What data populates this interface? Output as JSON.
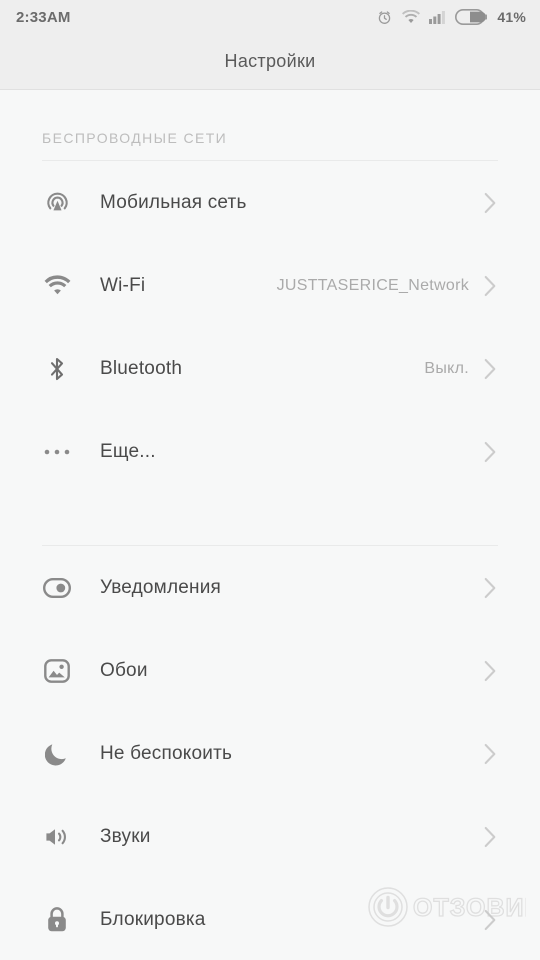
{
  "status_bar": {
    "time": "2:33AM",
    "battery_percent": "41%",
    "icons": [
      "alarm-clock-icon",
      "wifi-icon",
      "cellular-signal-icon",
      "battery-icon"
    ]
  },
  "header": {
    "title": "Настройки"
  },
  "sections": [
    {
      "header": "БЕСПРОВОДНЫЕ СЕТИ",
      "items": [
        {
          "icon": "cell-tower-icon",
          "label": "Мобильная сеть",
          "value": ""
        },
        {
          "icon": "wifi-icon",
          "label": "Wi-Fi",
          "value": "JUSTTASERICE_Network"
        },
        {
          "icon": "bluetooth-icon",
          "label": "Bluetooth",
          "value": "Выкл."
        },
        {
          "icon": "more-dots-icon",
          "label": "Еще...",
          "value": ""
        }
      ]
    },
    {
      "header": "",
      "items": [
        {
          "icon": "notifications-icon",
          "label": "Уведомления",
          "value": ""
        },
        {
          "icon": "wallpaper-icon",
          "label": "Обои",
          "value": ""
        },
        {
          "icon": "do-not-disturb-icon",
          "label": "Не беспокоить",
          "value": ""
        },
        {
          "icon": "sound-icon",
          "label": "Звуки",
          "value": ""
        },
        {
          "icon": "lock-icon",
          "label": "Блокировка",
          "value": ""
        }
      ]
    }
  ],
  "watermark": {
    "text": "ОТЗОВИК"
  },
  "colors": {
    "page_background": "#f7f8f8",
    "bar_background": "#eeeeee",
    "label_text": "#4a4a4a",
    "value_text": "#aaaaaa",
    "section_header_text": "#bdbdbd",
    "divider": "#e9eaea",
    "icon": "#8a8a8a"
  }
}
